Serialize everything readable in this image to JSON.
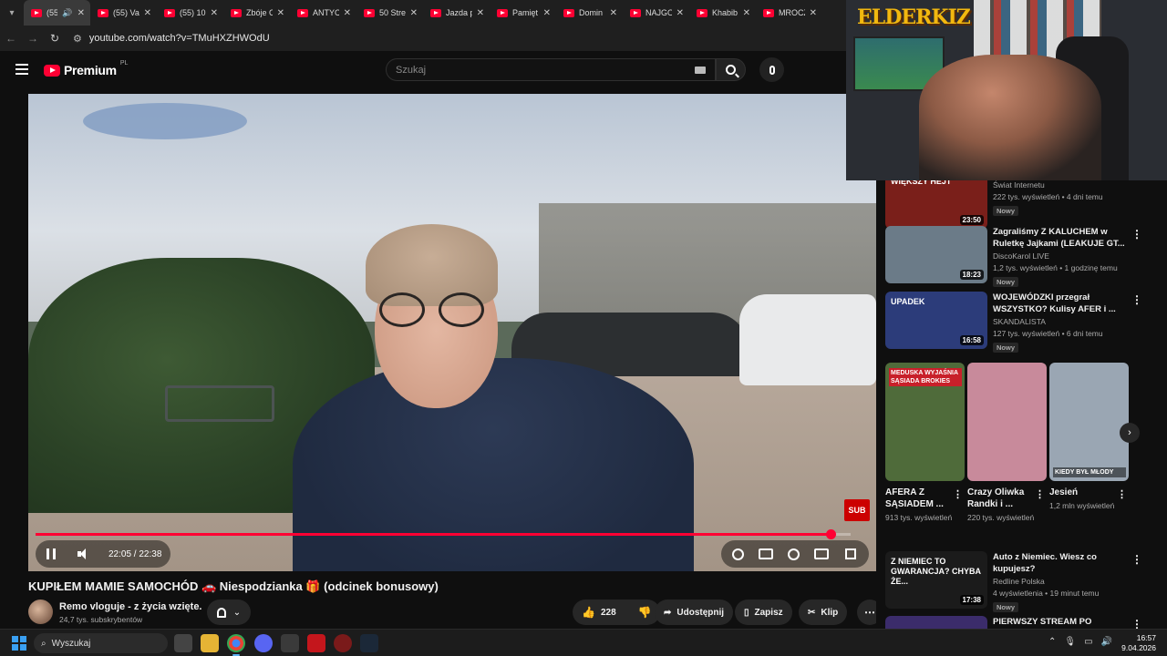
{
  "browser": {
    "tabs": [
      {
        "title": "(55)",
        "active": true
      },
      {
        "title": "(55) Va"
      },
      {
        "title": "(55) 10"
      },
      {
        "title": "Zbóje C"
      },
      {
        "title": "ANTYC"
      },
      {
        "title": "50 Stre"
      },
      {
        "title": "Jazda p"
      },
      {
        "title": "Pamięt"
      },
      {
        "title": "Domin"
      },
      {
        "title": "NAJGO"
      },
      {
        "title": "Khabib"
      },
      {
        "title": "MROCZ"
      }
    ],
    "url": "youtube.com/watch?v=TMuHXZHWOdU"
  },
  "header": {
    "logo_text": "Premium",
    "region": "PL",
    "search_placeholder": "Szukaj"
  },
  "player": {
    "time": "22:05 / 22:38",
    "progress_fraction": 0.975,
    "sub_badge": "SUB"
  },
  "video": {
    "title": "KUPIŁEM MAMIE SAMOCHÓD 🚗 Niespodzianka 🎁 (odcinek bonusowy)",
    "channel": "Remo vloguje - z życia wzięte.",
    "subscribers": "24,7 tys. subskrybentów",
    "likes": "228",
    "share_label": "Udostępnij",
    "save_label": "Zapisz",
    "clip_label": "Klip"
  },
  "webcam": {
    "logo": "ELDERKIZ"
  },
  "sidebar": {
    "videos": [
      {
        "thumb_text": "WIĘKSZY HEJT",
        "duration": "23:50",
        "title": "",
        "channel": "Świat Internetu",
        "meta": "222 tys. wyświetleń • 4 dni temu",
        "badge": "Nowy",
        "thumb_color": "#7a1f1a"
      },
      {
        "thumb_text": "",
        "duration": "18:23",
        "title": "Zagraliśmy Z KALUCHEM w Ruletkę Jajkami (LEAKUJE GT...",
        "channel": "DiscoKarol LIVE",
        "meta": "1,2 tys. wyświetleń • 1 godzinę temu",
        "badge": "Nowy",
        "thumb_color": "#6b7b88"
      },
      {
        "thumb_text": "UPADEK",
        "duration": "16:58",
        "title": "WOJEWÓDZKI przegrał WSZYSTKO? Kulisy AFER i ...",
        "channel": "SKANDALISTA",
        "meta": "127 tys. wyświetleń • 6 dni temu",
        "badge": "Nowy",
        "thumb_color": "#2c3c7a"
      },
      {
        "thumb_text": "Z NIEMIEC TO GWARANCJA? CHYBA ŻE...",
        "duration": "17:38",
        "title": "Auto z Niemiec. Wiesz co kupujesz?",
        "channel": "Redline Polska",
        "meta": "4 wyświetlenia • 19 minut temu",
        "badge": "Nowy",
        "thumb_color": "#1b1b1b"
      },
      {
        "thumb_text": "",
        "duration": "",
        "title": "PIERWSZY STREAM PO",
        "channel": "",
        "meta": "",
        "badge": "",
        "thumb_color": "#3b2c6b"
      }
    ],
    "shorts": [
      {
        "thumb_text": "MEDUSKA WYJAŚNIA SĄSIADA BROKIES",
        "title": "AFERA Z SĄSIADEM ...",
        "views": "913 tys. wyświetleń",
        "thumb_color": "#4f6b3a"
      },
      {
        "thumb_text": "",
        "title": "Crazy Oliwka Randki i ...",
        "views": "220 tys. wyświetleń",
        "thumb_color": "#c88a9b"
      },
      {
        "thumb_text": "KIEDY BYŁ MŁODY",
        "title": "Jesień",
        "views": "1,2 mln wyświetleń",
        "thumb_color": "#9aa6b3"
      }
    ]
  },
  "taskbar": {
    "search_label": "Wyszukaj",
    "time": "16:57",
    "date": "9.04.2026"
  },
  "colors": {
    "youtube_red": "#ff0033",
    "background": "#0f0f0f"
  }
}
